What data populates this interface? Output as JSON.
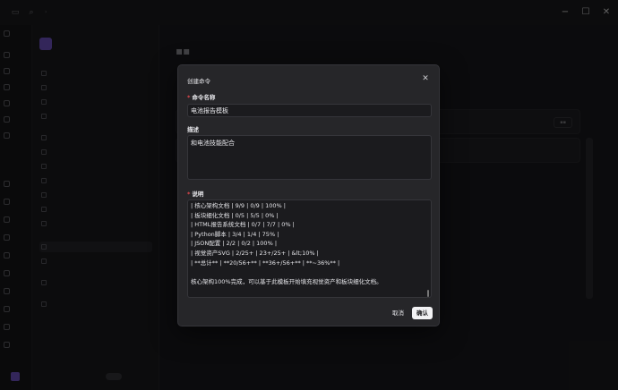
{
  "sidebar": {
    "brand_name": "",
    "brand_tag": ""
  },
  "footer": {
    "user_name": "",
    "user_tag": ""
  },
  "modal": {
    "title": "创建命令",
    "name_label": "命令名称",
    "name_value": "电池报告模板",
    "desc_label": "描述",
    "desc_value": "和电池技能配合",
    "notes_label": "说明",
    "notes_lines": [
      "| 核心架构文档 | 9/9 | 0/9 | 100% |",
      "| 板块细化文档 | 0/5 | 5/5 | 0% |",
      "| HTML报告系统文档 | 0/7 | 7/7 | 0% |",
      "| Python脚本 | 3/4 | 1/4 | 75% |",
      "| JSON配置 | 2/2 | 0/2 | 100% |",
      "| 视觉资产SVG | 2/25+ | 23+/25+ | &lt;10% |",
      "| **总计** | **20/56+** | **36+/56+** | **~36%** |",
      "",
      "核心架构100%完成，可以基于此模板开始填充视觉资产和板块细化文档。"
    ],
    "cancel_label": "取消",
    "confirm_label": "确认"
  },
  "colors": {
    "accent": "#7b5cd6",
    "required": "#e5484d",
    "modal_bg": "#262629",
    "input_bg": "#1b1b1e"
  }
}
